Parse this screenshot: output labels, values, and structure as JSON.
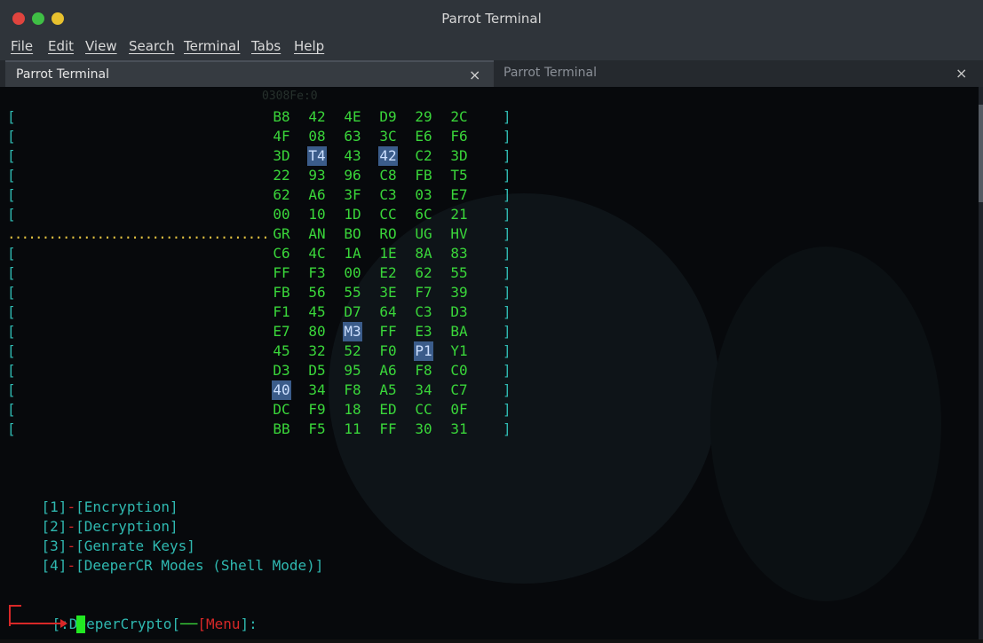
{
  "window": {
    "title": "Parrot Terminal",
    "controls": [
      "close",
      "minimize",
      "maximize"
    ],
    "colors": {
      "close": "#e0443e",
      "minimize": "#3fbf45",
      "maximize": "#e8c12e"
    }
  },
  "menu": [
    "File",
    "Edit",
    "View",
    "Search",
    "Terminal",
    "Tabs",
    "Help"
  ],
  "tabs": [
    {
      "label": "Parrot Terminal",
      "active": true,
      "close": "×"
    },
    {
      "label": "Parrot Terminal",
      "active": false,
      "close": "×"
    }
  ],
  "grid": {
    "top_label": "0308Fe:0",
    "open_bracket": "[",
    "close_bracket": "]",
    "separator_row_index": 6,
    "separator_dots": "......................................",
    "rows": [
      [
        "B8",
        "42",
        "4E",
        "D9",
        "29",
        "2C"
      ],
      [
        "4F",
        "08",
        "63",
        "3C",
        "E6",
        "F6"
      ],
      [
        "3D",
        "T4",
        "43",
        "42",
        "C2",
        "3D"
      ],
      [
        "22",
        "93",
        "96",
        "C8",
        "FB",
        "T5"
      ],
      [
        "62",
        "A6",
        "3F",
        "C3",
        "03",
        "E7"
      ],
      [
        "00",
        "10",
        "1D",
        "CC",
        "6C",
        "21"
      ],
      [
        "GR",
        "AN",
        "BO",
        "RO",
        "UG",
        "HV"
      ],
      [
        "C6",
        "4C",
        "1A",
        "1E",
        "8A",
        "83"
      ],
      [
        "FF",
        "F3",
        "00",
        "E2",
        "62",
        "55"
      ],
      [
        "FB",
        "56",
        "55",
        "3E",
        "F7",
        "39"
      ],
      [
        "F1",
        "45",
        "D7",
        "64",
        "C3",
        "D3"
      ],
      [
        "E7",
        "80",
        "M3",
        "FF",
        "E3",
        "BA"
      ],
      [
        "45",
        "32",
        "52",
        "F0",
        "P1",
        "Y1"
      ],
      [
        "D3",
        "D5",
        "95",
        "A6",
        "F8",
        "C0"
      ],
      [
        "40",
        "34",
        "F8",
        "A5",
        "34",
        "C7"
      ],
      [
        "DC",
        "F9",
        "18",
        "ED",
        "CC",
        "0F"
      ],
      [
        "BB",
        "F5",
        "11",
        "FF",
        "30",
        "31"
      ]
    ],
    "highlighted": [
      [
        2,
        1
      ],
      [
        2,
        3
      ],
      [
        11,
        2
      ],
      [
        12,
        4
      ],
      [
        14,
        0
      ]
    ]
  },
  "options": [
    {
      "num": "[1]",
      "dash": "-",
      "label": "[Encryption]"
    },
    {
      "num": "[2]",
      "dash": "-",
      "label": "[Decryption]"
    },
    {
      "num": "[3]",
      "dash": "-",
      "label": "[Genrate Keys]"
    },
    {
      "num": "[4]",
      "dash": "-",
      "label": "[DeeperCR Modes (Shell Mode)]"
    }
  ],
  "prompt": {
    "open": "[",
    "name": ":DeeperCrypto",
    "mid": "[",
    "dashes": "──",
    "menu_open": "[",
    "menu": "Menu",
    "menu_close": "]",
    "suffix": ":"
  }
}
